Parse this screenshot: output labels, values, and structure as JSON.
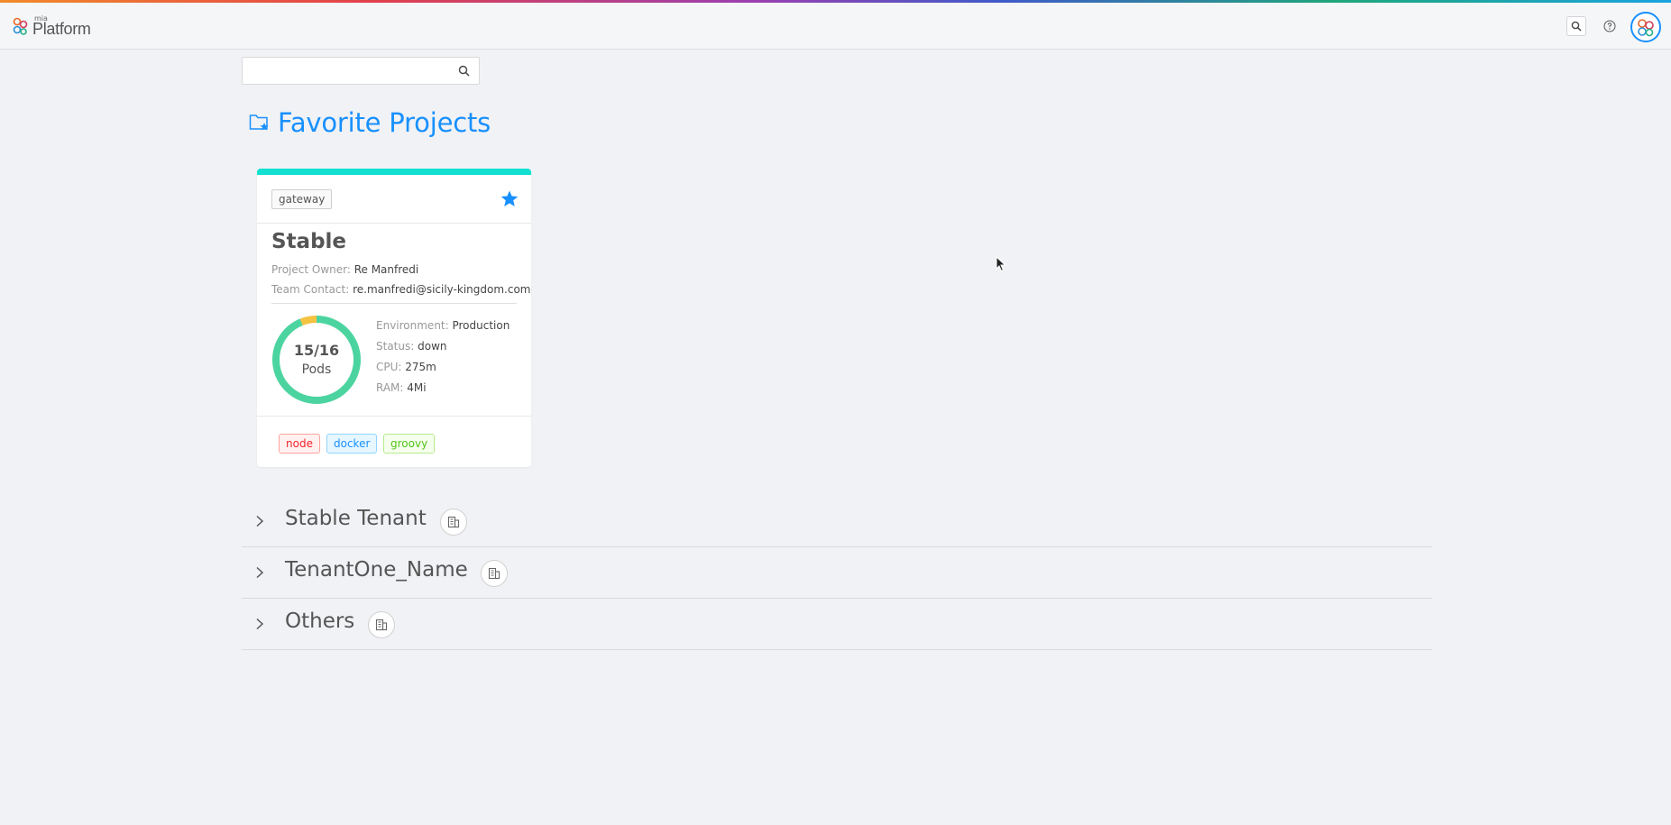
{
  "header": {
    "logo_small": "mia",
    "logo_main": "Platform"
  },
  "search": {
    "placeholder": "",
    "value": ""
  },
  "favorites": {
    "title": "Favorite Projects"
  },
  "project_card": {
    "tag": "gateway",
    "name": "Stable",
    "owner_label": "Project Owner: ",
    "owner": "Re Manfredi",
    "contact_label": "Team Contact: ",
    "contact": "re.manfredi@sicily-kingdom.com",
    "pods_count": "15/16",
    "pods_label": "Pods",
    "pods_ready": 15,
    "pods_total": 16,
    "env_label": "Environment: ",
    "env": "Production",
    "status_label": "Status: ",
    "status": "down",
    "cpu_label": "CPU: ",
    "cpu": "275m",
    "ram_label": "RAM: ",
    "ram": "4Mi",
    "tags": [
      "node",
      "docker",
      "groovy"
    ]
  },
  "tenants": [
    {
      "name": "Stable Tenant"
    },
    {
      "name": "TenantOne_Name"
    },
    {
      "name": "Others"
    }
  ],
  "colors": {
    "accent": "#1890ff",
    "card_bar": "#13e0d0",
    "donut_ok": "#4cd4a0",
    "donut_warn": "#f5c342"
  }
}
